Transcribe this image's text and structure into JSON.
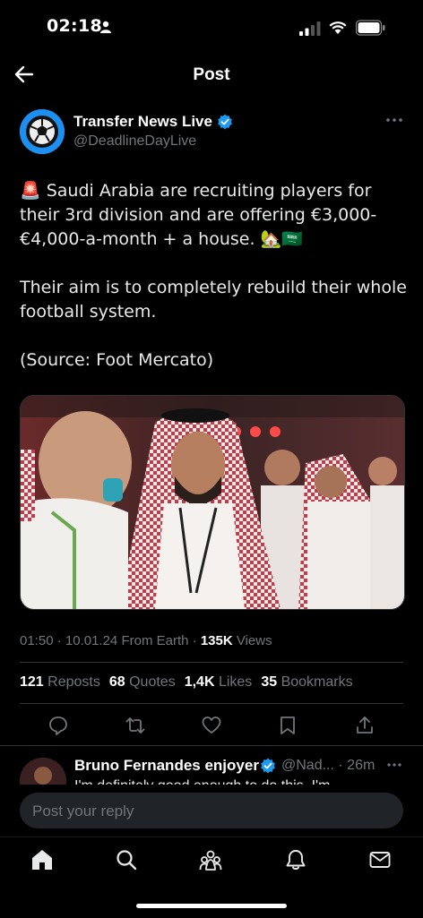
{
  "status_bar": {
    "time": "02:18",
    "icons": [
      "person-icon",
      "cellular-signal-icon",
      "wifi-icon",
      "battery-icon"
    ]
  },
  "header": {
    "back_icon": "arrow-left-icon",
    "title": "Post"
  },
  "post": {
    "author": {
      "name": "Transfer News Live",
      "handle": "@DeadlineDayLive",
      "verified": true
    },
    "text": {
      "line1": "🚨 Saudi Arabia are recruiting players for their 3rd division and are offering €3,000-€4,000-a-month + a house. 🏡🇸🇦",
      "line2": "Their aim is to completely rebuild their whole football system.",
      "line3": "(Source: Foot Mercato)"
    },
    "meta": {
      "time": "01:50",
      "date": "10.01.24",
      "source": "From Earth",
      "views_count": "135K",
      "views_label": "Views"
    },
    "stats": {
      "reposts_count": "121",
      "reposts_label": "Reposts",
      "quotes_count": "68",
      "quotes_label": "Quotes",
      "likes_count": "1,4K",
      "likes_label": "Likes",
      "bookmarks_count": "35",
      "bookmarks_label": "Bookmarks"
    }
  },
  "reply": {
    "name": "Bruno Fernandes enjoyer",
    "handle": "@Nad...",
    "time": "· 26m",
    "text": "I'm definitely good enough to do this. I'm"
  },
  "compose": {
    "placeholder": "Post your reply"
  },
  "tabbar": {
    "items": [
      "home-icon",
      "search-icon",
      "communities-icon",
      "notifications-icon",
      "messages-icon"
    ]
  },
  "colors": {
    "background": "#000000",
    "verified": "#1d9bf0",
    "muted": "#71767b"
  }
}
